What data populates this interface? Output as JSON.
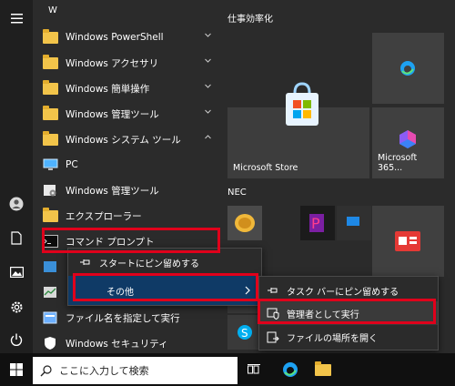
{
  "start_menu": {
    "section_letter": "W",
    "apps": [
      {
        "label": "Windows PowerShell",
        "icon": "folder-icon",
        "expandable": true
      },
      {
        "label": "Windows アクセサリ",
        "icon": "folder-icon",
        "expandable": true
      },
      {
        "label": "Windows 簡単操作",
        "icon": "folder-icon",
        "expandable": true
      },
      {
        "label": "Windows 管理ツール",
        "icon": "folder-icon",
        "expandable": true
      },
      {
        "label": "Windows システム ツール",
        "icon": "folder-icon",
        "expanded": true
      },
      {
        "label": "PC",
        "icon": "pc-icon"
      },
      {
        "label": "Windows 管理ツール",
        "icon": "admin-tools-icon"
      },
      {
        "label": "エクスプローラー",
        "icon": "file-explorer-icon"
      },
      {
        "label": "コマンド プロンプト",
        "icon": "command-prompt-icon"
      },
      {
        "label": "ファイル名を指定して実行",
        "icon": "run-icon"
      },
      {
        "label": "Windows セキュリティ",
        "icon": "shield-icon"
      }
    ]
  },
  "tiles": {
    "group1_title": "仕事効率化",
    "group2_title": "NEC",
    "microsoft_store": "Microsoft Store",
    "microsoft_365": "Microsoft 365..."
  },
  "context_menu": {
    "pin_start": "スタートにピン留めする",
    "more": "その他"
  },
  "submenu": {
    "pin_taskbar": "タスク バーにピン留めする",
    "run_as_admin": "管理者として実行",
    "open_location": "ファイルの場所を開く"
  },
  "taskbar": {
    "search_placeholder": "ここに入力して検索"
  },
  "colors": {
    "highlight_red": "#e0001b",
    "folder_yellow": "#f2c44a",
    "accent_blue": "#0078d4"
  }
}
